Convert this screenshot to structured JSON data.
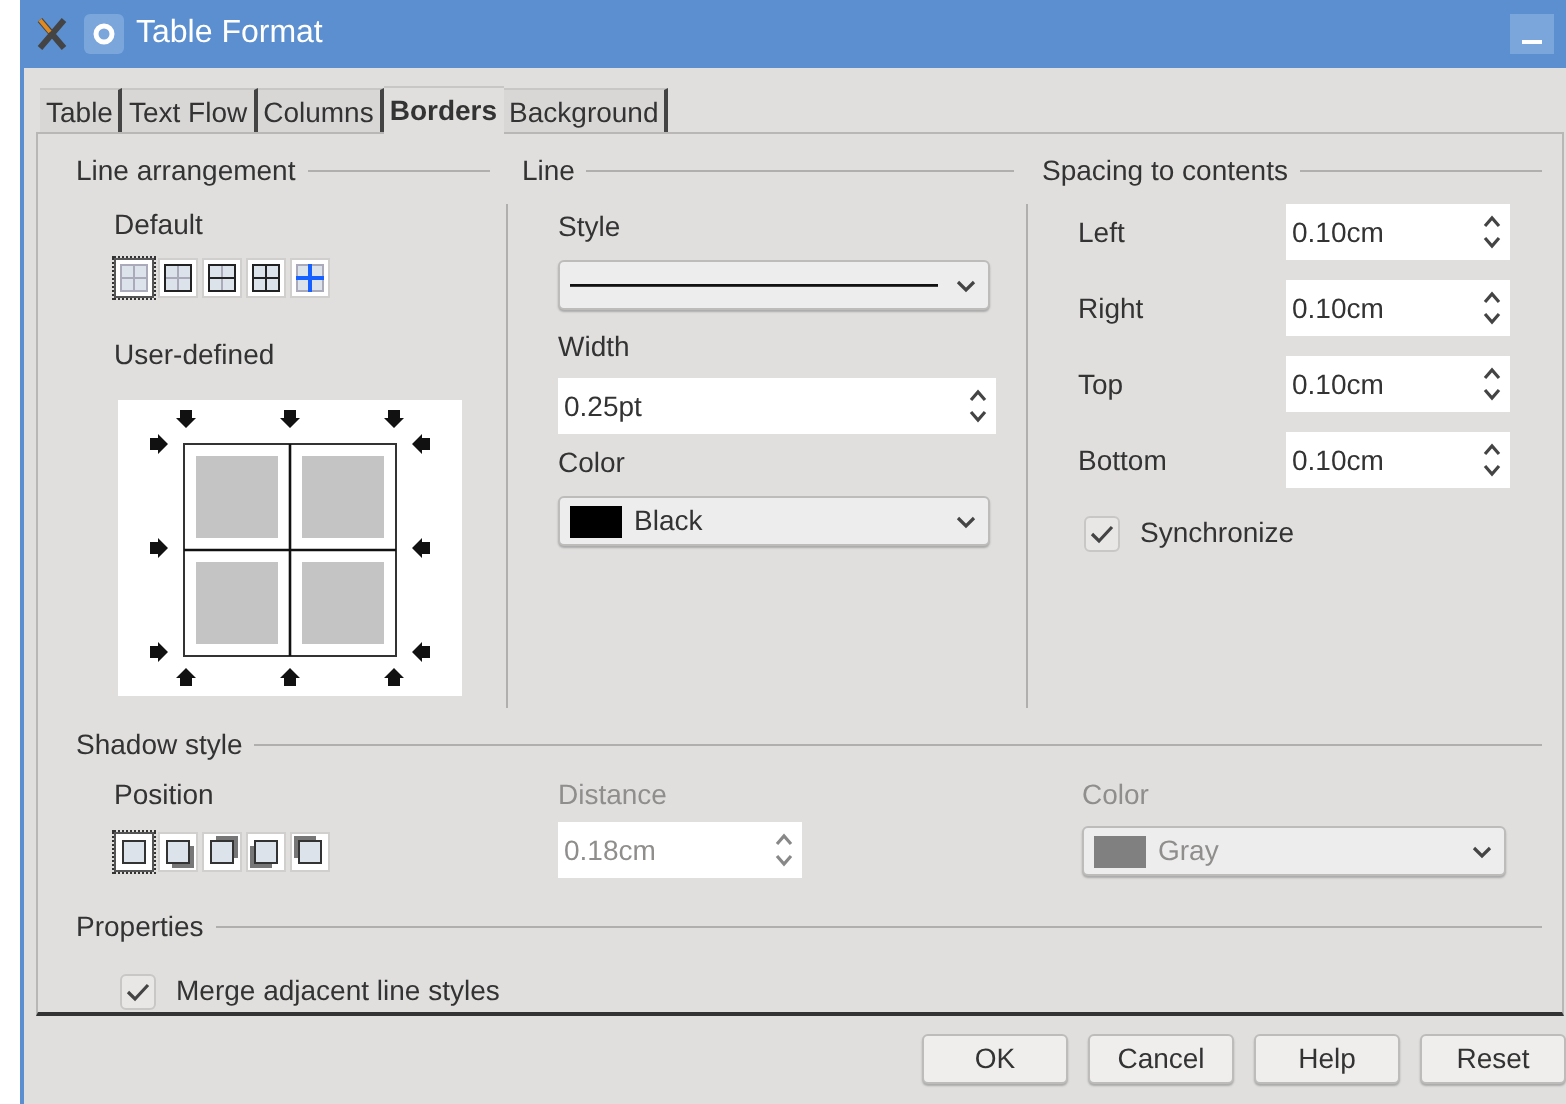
{
  "window": {
    "title": "Table Format"
  },
  "tabs": [
    {
      "label": "Table",
      "selected": false
    },
    {
      "label": "Text Flow",
      "selected": false
    },
    {
      "label": "Columns",
      "selected": false
    },
    {
      "label": "Borders",
      "selected": true
    },
    {
      "label": "Background",
      "selected": false
    }
  ],
  "line_arrangement": {
    "heading": "Line arrangement",
    "default_label": "Default",
    "presets": [
      {
        "kind": "none",
        "selected": true
      },
      {
        "kind": "outer",
        "selected": false
      },
      {
        "kind": "outer-horizontal",
        "selected": false
      },
      {
        "kind": "outer-all",
        "selected": false
      },
      {
        "kind": "inner",
        "selected": false
      }
    ],
    "user_defined_label": "User-defined"
  },
  "line": {
    "heading": "Line",
    "style_label": "Style",
    "width_label": "Width",
    "width_value": "0.25pt",
    "color_label": "Color",
    "color_value": "Black",
    "color": "#000000"
  },
  "spacing": {
    "heading": "Spacing to contents",
    "fields": [
      {
        "label": "Left",
        "value": "0.10cm"
      },
      {
        "label": "Right",
        "value": "0.10cm"
      },
      {
        "label": "Top",
        "value": "0.10cm"
      },
      {
        "label": "Bottom",
        "value": "0.10cm"
      }
    ],
    "synchronize": {
      "label": "Synchronize",
      "checked": true
    }
  },
  "shadow": {
    "heading": "Shadow style",
    "position_label": "Position",
    "positions": [
      {
        "kind": "none",
        "selected": true
      },
      {
        "kind": "bottom-right",
        "selected": false
      },
      {
        "kind": "top-right",
        "selected": false
      },
      {
        "kind": "bottom-left",
        "selected": false
      },
      {
        "kind": "top-left",
        "selected": false
      }
    ],
    "distance_label": "Distance",
    "distance_value": "0.18cm",
    "distance_disabled": true,
    "color_label": "Color",
    "color_value": "Gray",
    "color": "#808080",
    "color_disabled": true
  },
  "properties": {
    "heading": "Properties",
    "merge": {
      "label": "Merge adjacent line styles",
      "checked": true
    }
  },
  "buttons": [
    "OK",
    "Cancel",
    "Help",
    "Reset"
  ]
}
